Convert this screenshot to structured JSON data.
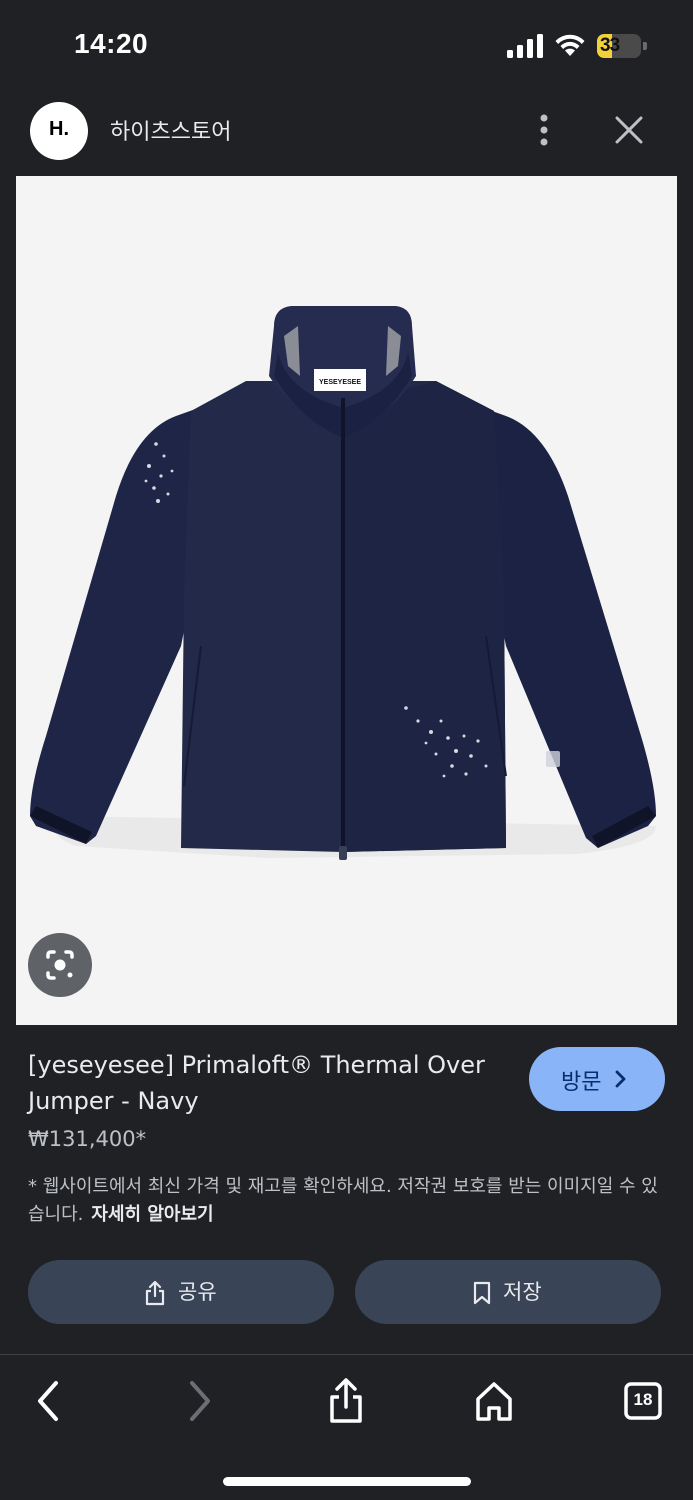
{
  "status_bar": {
    "time": "14:20",
    "battery_level": "33",
    "battery_fraction": 0.33,
    "icons": [
      "signal-icon",
      "wifi-icon",
      "battery-charging-icon"
    ]
  },
  "header": {
    "logo_text": "H.",
    "site_name": "하이츠스토어",
    "icons": [
      "more-vertical-icon",
      "close-icon"
    ]
  },
  "image": {
    "label_tag_text": "YESEYESEE",
    "lens_icon": "google-lens-icon"
  },
  "product": {
    "title": "[yeseyesee] Primaloft® Thermal Over Jumper - Navy",
    "price": "₩131,400*",
    "visit_label": "방문",
    "disclaimer": "* 웹사이트에서 최신 가격 및 재고를 확인하세요. 저작권 보호를 받는 이미지일 수 있습니다.",
    "learn_more": "자세히 알아보기",
    "share_label": "공유",
    "save_label": "저장"
  },
  "toolbar": {
    "tab_count": "18",
    "icons": [
      "back-icon",
      "forward-icon",
      "share-icon",
      "home-icon",
      "tabs-icon"
    ]
  },
  "colors": {
    "background": "#202124",
    "visit_button": "#8ab4f8",
    "action_button": "#394457",
    "jacket_navy": "#1f2547"
  }
}
